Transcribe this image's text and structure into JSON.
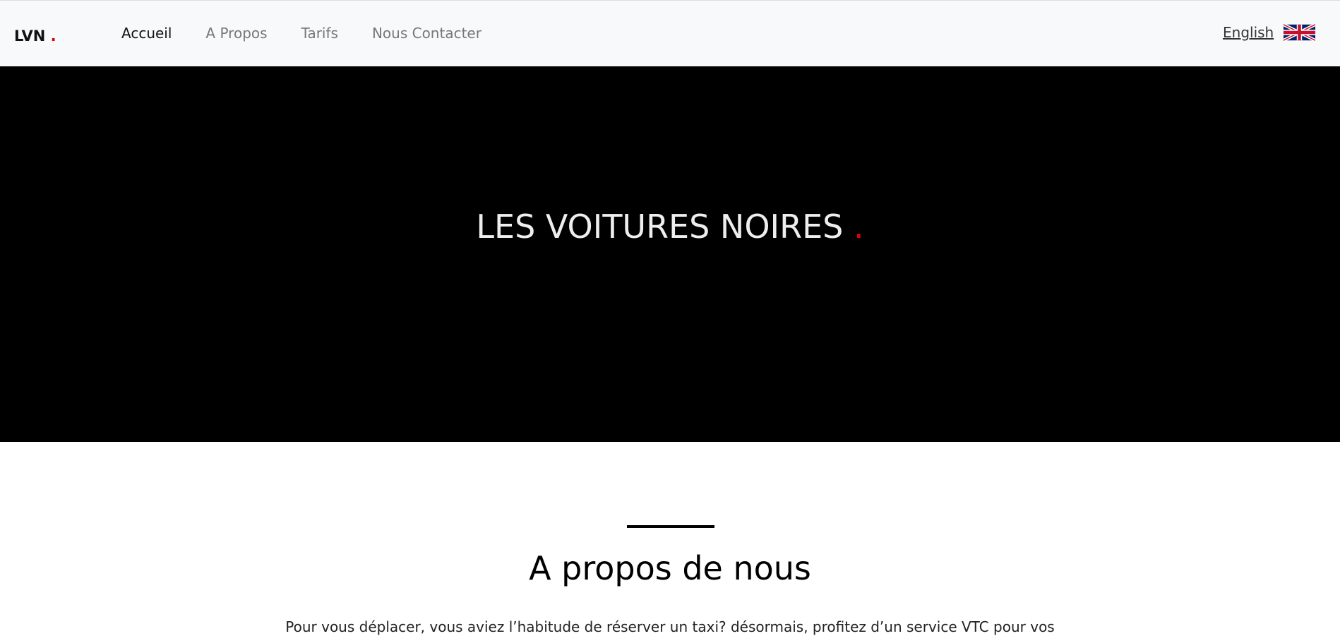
{
  "nav": {
    "logo": "LVN",
    "logo_dot": ".",
    "links": [
      "Accueil",
      "A Propos",
      "Tarifs",
      "Nous Contacter"
    ],
    "language": "English",
    "flag_icon": "uk-flag-icon"
  },
  "hero": {
    "title": "LES VOITURES NOIRES",
    "dot": "."
  },
  "about": {
    "heading": "A propos de nous",
    "text": "Pour vous déplacer, vous aviez l’habitude de réserver un taxi? désormais, profitez d’un service VTC pour vos"
  },
  "colors": {
    "accent": "#e00000",
    "nav_bg": "#f8f9fb",
    "hero_bg": "#000000"
  }
}
